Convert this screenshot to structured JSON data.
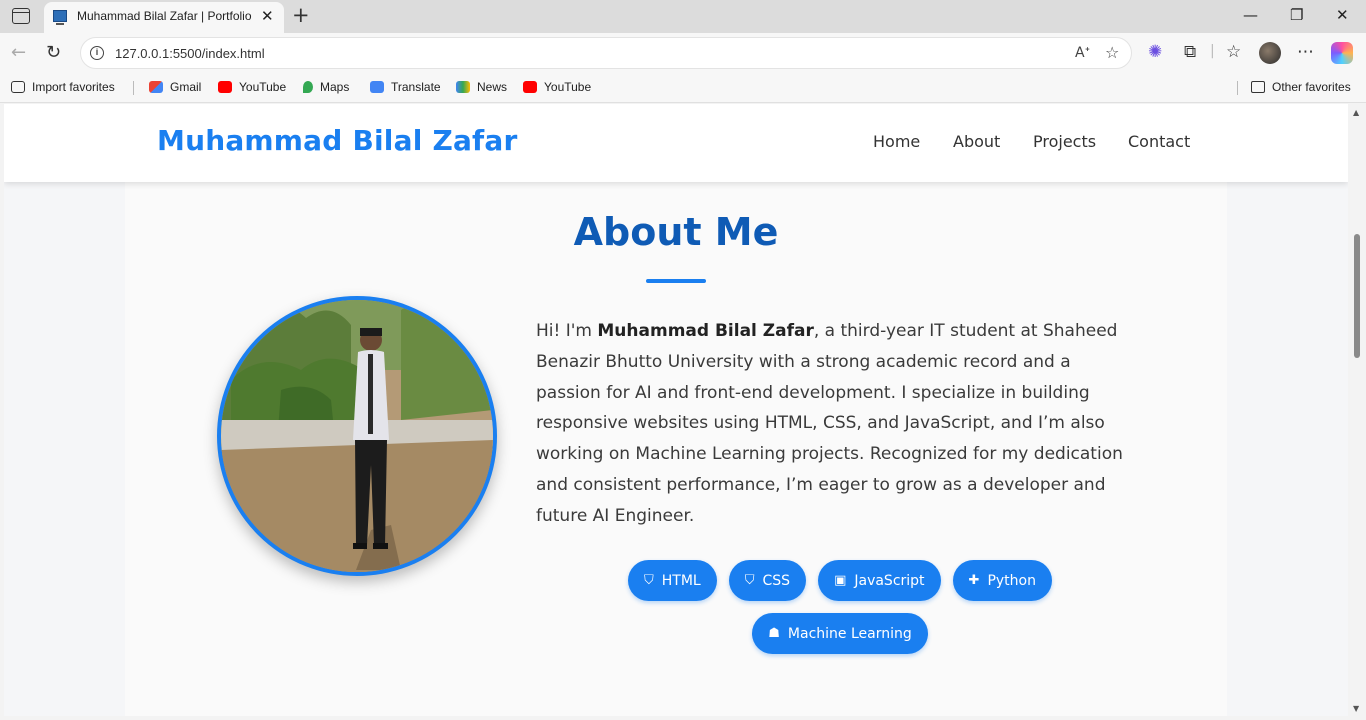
{
  "browser": {
    "tab_title": "Muhammad Bilal Zafar | Portfolio",
    "url": "127.0.0.1:5500/index.html",
    "bookmarks": [
      {
        "label": "Import favorites",
        "icon": "import-icon"
      },
      {
        "label": "Gmail",
        "icon": "gmail-icon"
      },
      {
        "label": "YouTube",
        "icon": "youtube-icon"
      },
      {
        "label": "Maps",
        "icon": "maps-icon"
      },
      {
        "label": "Translate",
        "icon": "translate-icon"
      },
      {
        "label": "News",
        "icon": "news-icon"
      },
      {
        "label": "YouTube",
        "icon": "youtube-icon"
      }
    ],
    "other_favorites": "Other favorites"
  },
  "site": {
    "logo": "Muhammad Bilal Zafar",
    "nav": [
      "Home",
      "About",
      "Projects",
      "Contact"
    ],
    "accent_color": "#1a7ff0"
  },
  "about": {
    "title": "About Me",
    "text_intro": "Hi! I'm ",
    "name": "Muhammad Bilal Zafar",
    "text_body": ", a third-year IT student at Shaheed Benazir Bhutto University with a strong academic record and a passion for AI and front-end development. I specialize in building responsive websites using HTML, CSS, and JavaScript, and I’m also working on Machine Learning projects. Recognized for my dedication and consistent performance, I’m eager to grow as a developer and future AI Engineer.",
    "skills": [
      {
        "label": "HTML",
        "icon": "html5-icon"
      },
      {
        "label": "CSS",
        "icon": "css3-icon"
      },
      {
        "label": "JavaScript",
        "icon": "js-icon"
      },
      {
        "label": "Python",
        "icon": "python-icon"
      },
      {
        "label": "Machine Learning",
        "icon": "robot-icon"
      }
    ]
  }
}
